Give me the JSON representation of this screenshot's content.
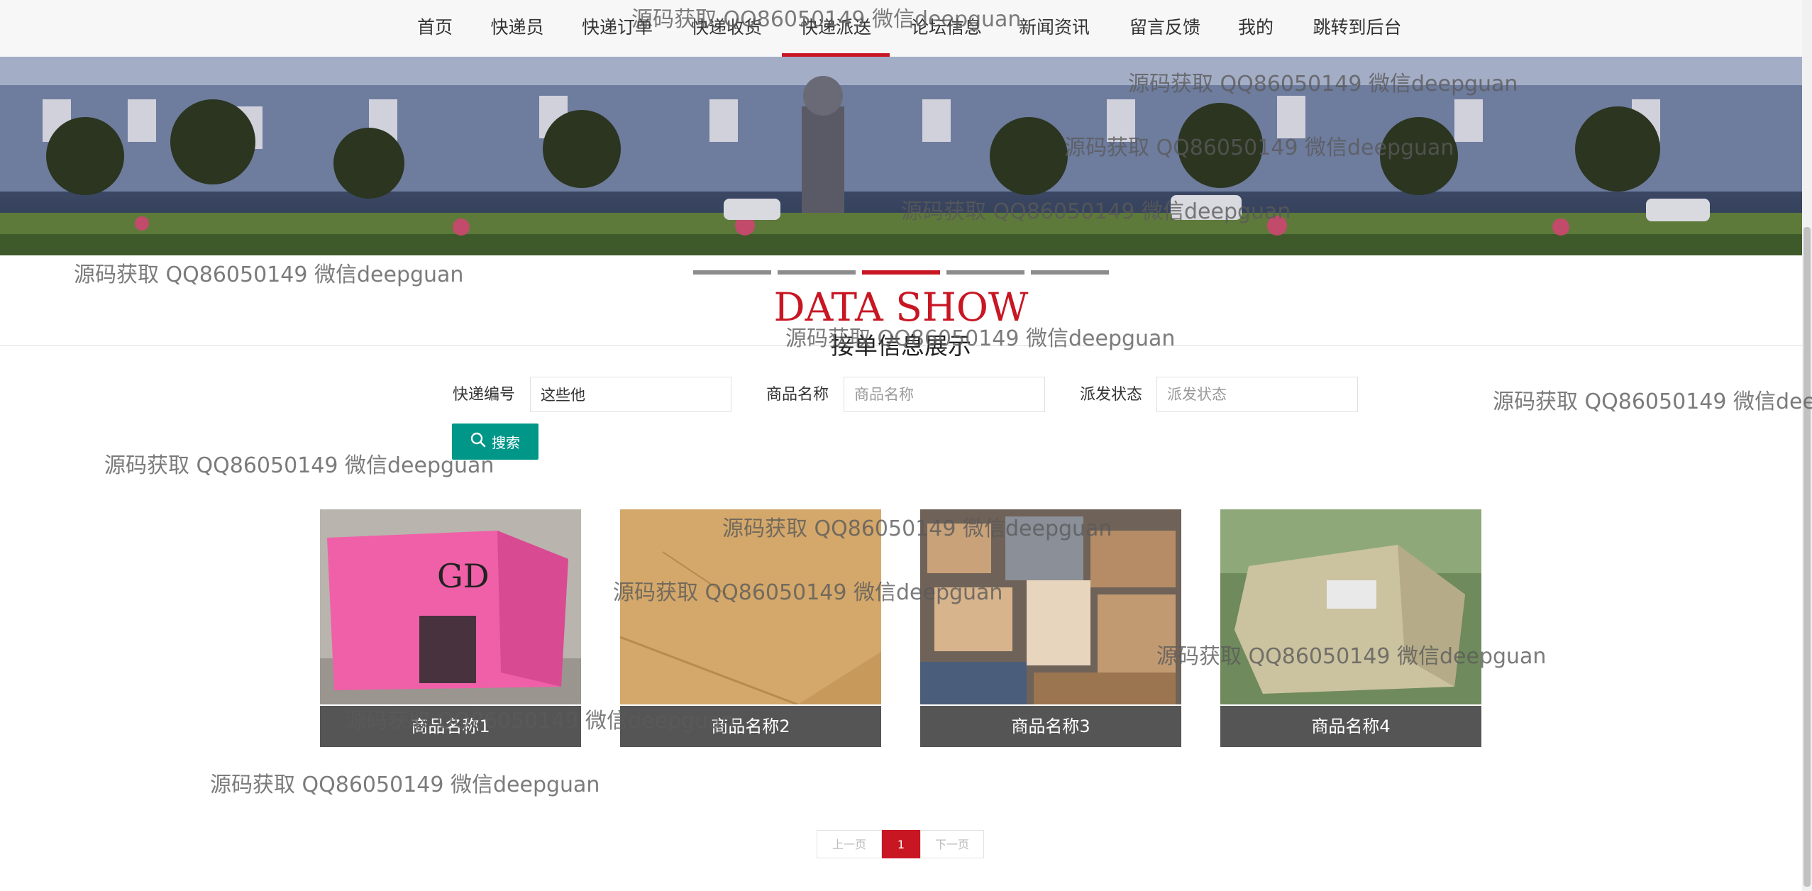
{
  "nav": {
    "items": [
      {
        "label": "首页"
      },
      {
        "label": "快递员"
      },
      {
        "label": "快递订单"
      },
      {
        "label": "快递收货"
      },
      {
        "label": "快递派送"
      },
      {
        "label": "论坛信息"
      },
      {
        "label": "新闻资讯"
      },
      {
        "label": "留言反馈"
      },
      {
        "label": "我的"
      },
      {
        "label": "跳转到后台"
      }
    ],
    "active_index": 4
  },
  "section": {
    "title_en": "DATA SHOW",
    "title_cn": "接单信息展示"
  },
  "search": {
    "fields": [
      {
        "label": "快递编号",
        "value": "这些他",
        "placeholder": ""
      },
      {
        "label": "商品名称",
        "value": "",
        "placeholder": "商品名称"
      },
      {
        "label": "派发状态",
        "value": "",
        "placeholder": "派发状态"
      }
    ],
    "button_label": "搜索",
    "button_icon": "search-icon"
  },
  "cards": [
    {
      "name": "商品名称1"
    },
    {
      "name": "商品名称2"
    },
    {
      "name": "商品名称3"
    },
    {
      "name": "商品名称4"
    }
  ],
  "pagination": {
    "prev": "上一页",
    "current": "1",
    "next": "下一页"
  },
  "watermark": "源码获取 QQ86050149 微信deepguan",
  "colors": {
    "accent": "#c81623",
    "search_button": "#009688",
    "caption_bg": "#555555"
  }
}
